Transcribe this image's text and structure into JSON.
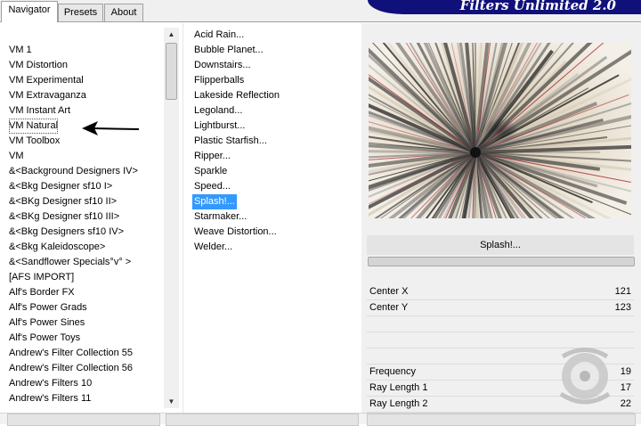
{
  "tabs": [
    "Navigator",
    "Presets",
    "About"
  ],
  "banner": {
    "title": "Filters Unlimited 2.0"
  },
  "categories": [
    "VM 1",
    "VM Distortion",
    "VM Experimental",
    "VM Extravaganza",
    "VM Instant Art",
    "VM Natural",
    "VM Toolbox",
    "VM",
    "&<Background Designers IV>",
    "&<Bkg Designer sf10 I>",
    "&<BKg Designer sf10 II>",
    "&<BKg Designer sf10 III>",
    "&<Bkg Designers sf10 IV>",
    "&<Bkg Kaleidoscope>",
    "&<Sandflower Specials°v° >",
    "[AFS IMPORT]",
    "Alf's Border FX",
    "Alf's Power Grads",
    "Alf's Power Sines",
    "Alf's Power Toys",
    "Andrew's Filter Collection 55",
    "Andrew's Filter Collection 56",
    "Andrew's Filters 10",
    "Andrew's Filters 11"
  ],
  "selected_category": "VM Natural",
  "filters": [
    "Acid Rain...",
    "Bubble Planet...",
    "Downstairs...",
    "Flipperballs",
    "Lakeside Reflection",
    "Legoland...",
    "Lightburst...",
    "Plastic Starfish...",
    "Ripper...",
    "Sparkle",
    "Speed...",
    "Splash!...",
    "Starmaker...",
    "Weave Distortion...",
    "Welder..."
  ],
  "selected_filter": "Splash!...",
  "current_filter_title": "Splash!...",
  "params": [
    {
      "label": "Center X",
      "value": "121"
    },
    {
      "label": "Center Y",
      "value": "123"
    },
    {
      "label": "Frequency",
      "value": "19"
    },
    {
      "label": "Ray Length 1",
      "value": "17"
    },
    {
      "label": "Ray Length 2",
      "value": "22"
    }
  ],
  "icons": {
    "scroll_up": "triangle-up",
    "scroll_down": "triangle-down",
    "annotation": "left-arrow"
  },
  "colors": {
    "banner": "#10107a",
    "selection": "#3399ff",
    "preview_ray_red": "#a01828"
  }
}
